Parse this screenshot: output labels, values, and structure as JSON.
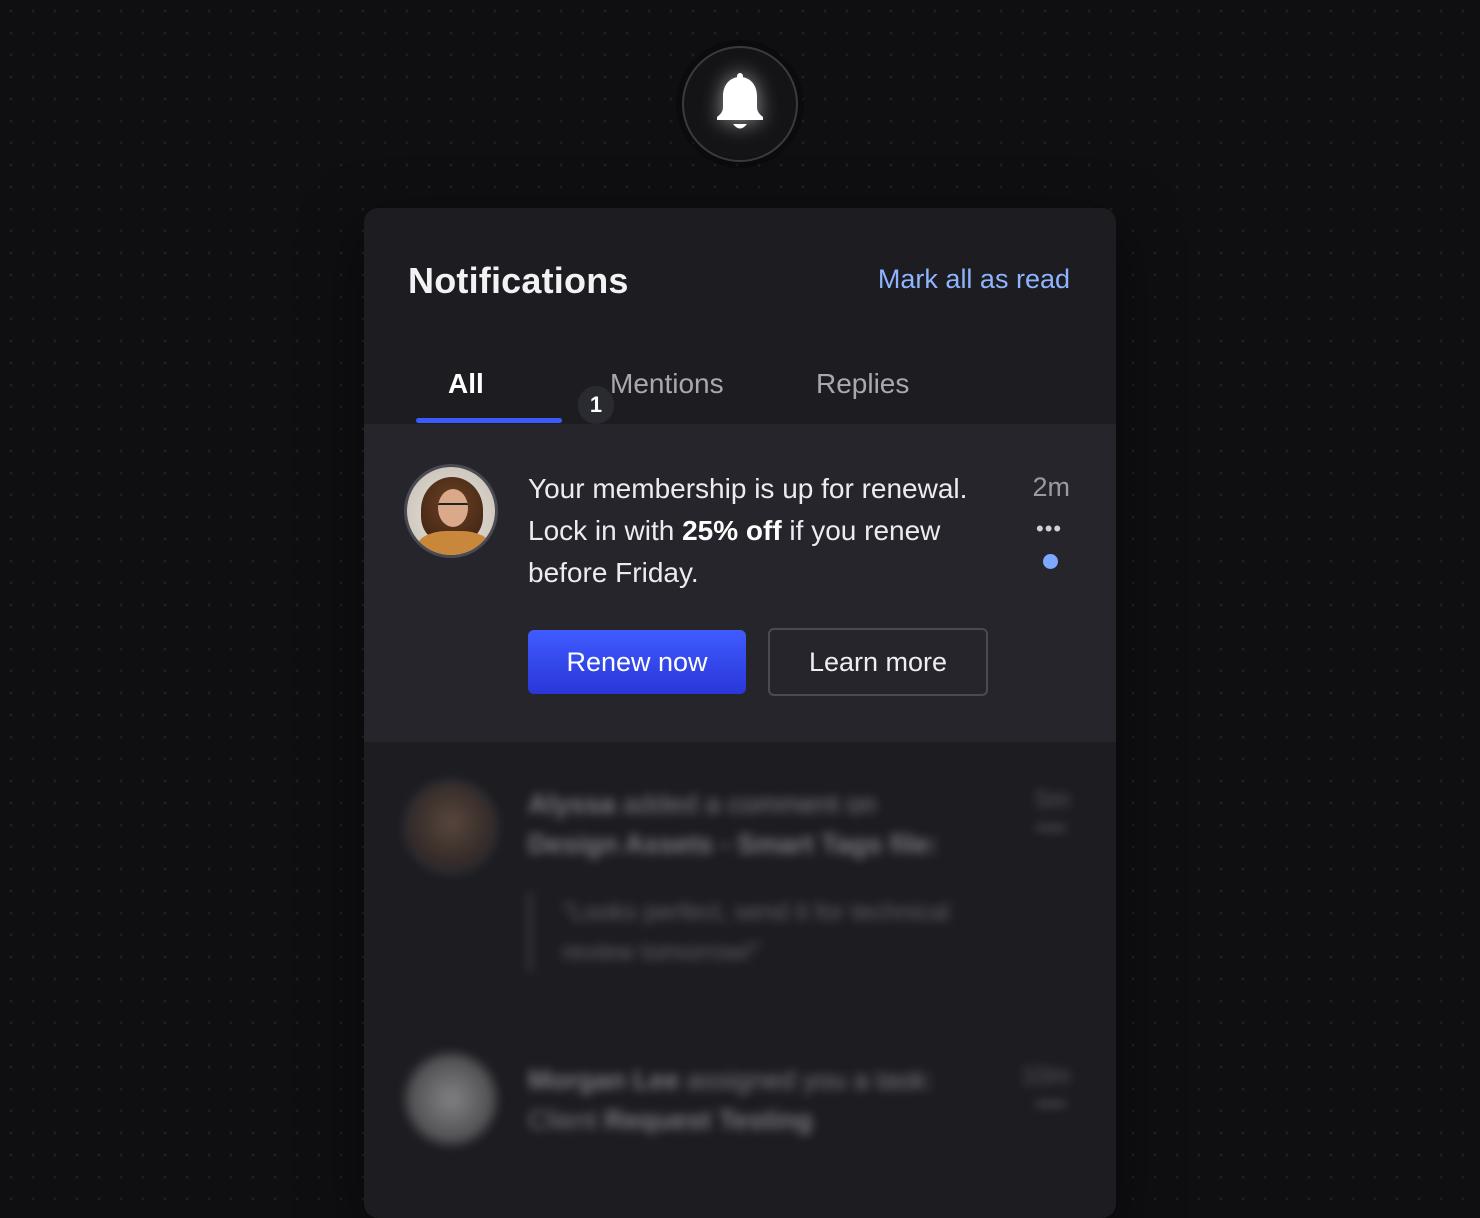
{
  "bell": {
    "icon": "bell-icon"
  },
  "header": {
    "title": "Notifications",
    "mark_all_read": "Mark all as read"
  },
  "tabs": [
    {
      "label": "All",
      "count": "1",
      "active": true
    },
    {
      "label": "Mentions",
      "active": false
    },
    {
      "label": "Replies",
      "active": false
    }
  ],
  "notifications": [
    {
      "line1": "Your membership is up for renewal.",
      "line2_pre": "Lock in with ",
      "line2_bold": "25% off",
      "line2_post": " if you renew",
      "line3": "before Friday.",
      "time": "2m",
      "more_icon": "more-horizontal-icon",
      "unread": true,
      "primary_action": "Renew now",
      "secondary_action": "Learn more",
      "accent_color": "#3b5bff"
    },
    {
      "actor": "Alyssa",
      "action": "added a comment on",
      "target": "Design Assets - Smart Tags file:",
      "quote": "“Looks perfect, send it for technical review tomorrow!”",
      "time": "5m"
    },
    {
      "actor": "Morgan Lee",
      "action": "assigned you a task:",
      "target_pre": "Client",
      "target": "Request Testing",
      "time": "10m"
    }
  ]
}
